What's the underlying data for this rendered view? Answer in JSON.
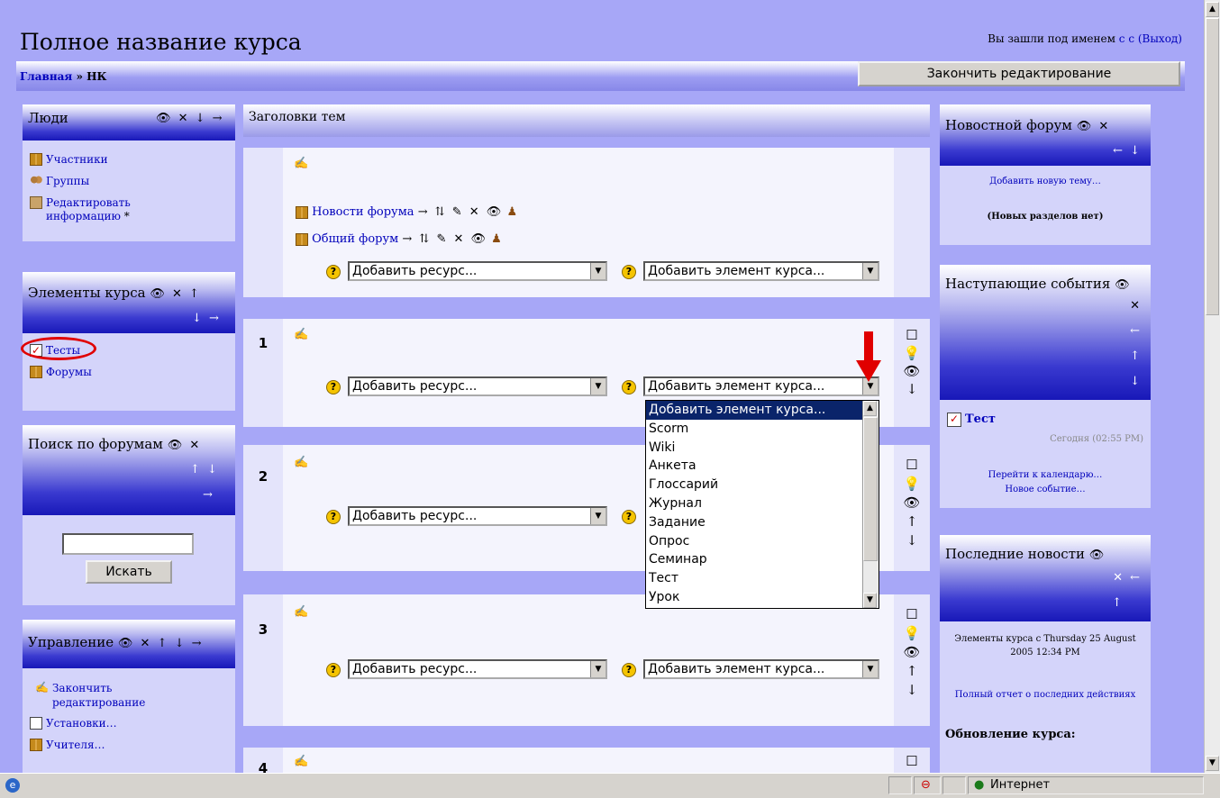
{
  "header": {
    "course_title": "Полное название курса",
    "login_text": "Вы зашли под именем",
    "user_name": "c c",
    "logout": "(Выход)",
    "breadcrumb_home": "Главная",
    "breadcrumb_sep": "»",
    "breadcrumb_current": "НК",
    "finish_edit_button": "Закончить редактирование"
  },
  "left": {
    "people": {
      "title": "Люди",
      "controls": "👁 ✕ ↓ →",
      "items": [
        "Участники",
        "Группы",
        "Редактировать",
        "информацию"
      ],
      "asterisk": "*"
    },
    "activities": {
      "title": "Элементы курса",
      "controls1": "👁 ✕ ↑",
      "controls2": "↓ →",
      "items": [
        "Тесты",
        "Форумы"
      ]
    },
    "search": {
      "title": "Поиск по форумам",
      "controls1": "👁 ✕",
      "controls2": "↑ ↓",
      "controls3": "→",
      "input_value": "",
      "button": "Искать"
    },
    "admin": {
      "title": "Управление",
      "controls": "👁 ✕ ↑ ↓ →",
      "items": [
        "Закончить",
        "редактирование",
        "Установки…",
        "Учителя…"
      ]
    }
  },
  "center": {
    "topics_header": "Заголовки тем",
    "forum_news": "Новости форума",
    "forum_general": "Общий форум",
    "forum_controls": "→ ⇅ ✎ ✕ 👁",
    "add_resource": "Добавить ресурс...",
    "add_activity": "Добавить элемент курса...",
    "add_activity_short": "Добавить элемент курса...",
    "section_numbers": [
      "1",
      "2",
      "3",
      "4"
    ],
    "side_controls": [
      "☐",
      "💡",
      "👁",
      "↑",
      "↓"
    ]
  },
  "dropdown": {
    "options": [
      "Добавить элемент курса...",
      "Scorm",
      "Wiki",
      "Анкета",
      "Глоссарий",
      "Журнал",
      "Задание",
      "Опрос",
      "Семинар",
      "Тест",
      "Урок"
    ],
    "selected_index": 0
  },
  "right": {
    "news_forum": {
      "title": "Новостной форум",
      "controls1": "👁 ✕",
      "controls2": "← ↓",
      "add_topic": "Добавить новую тему…",
      "no_topics": "(Новых разделов нет)"
    },
    "upcoming": {
      "title": "Наступающие события",
      "controls": [
        "👁",
        "✕",
        "←",
        "↑",
        "↓"
      ],
      "event_name": "Тест",
      "event_time": "Сегодня (02:55 PM)",
      "goto_calendar": "Перейти к календарю…",
      "new_event": "Новое событие…"
    },
    "recent": {
      "title": "Последние новости",
      "controls1": "👁",
      "controls2": "✕ ←",
      "controls3": "↑",
      "since": "Элементы курса с Thursday 25 August 2005 12:34 PM",
      "full_report": "Полный отчет о последних действиях",
      "course_updates": "Обновление курса:"
    }
  },
  "statusbar": {
    "zone": "Интернет"
  },
  "colors": {
    "page_bg": "#a7a7f7",
    "block_bg": "#d4d4fa",
    "header_dark": "#1818b8",
    "highlight_red": "#e00000"
  }
}
